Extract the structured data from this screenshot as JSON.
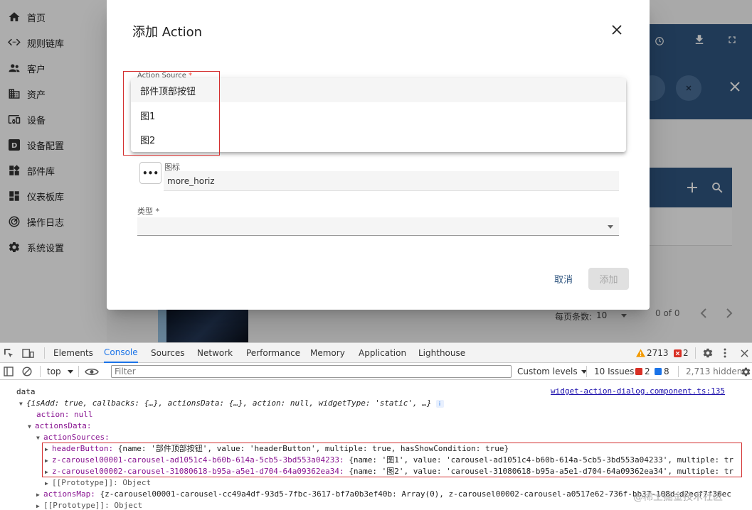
{
  "sidebar": {
    "items": [
      {
        "label": "首页",
        "icon": "home-icon"
      },
      {
        "label": "规则链库",
        "icon": "settings-ethernet-icon"
      },
      {
        "label": "客户",
        "icon": "supervisor-account-icon"
      },
      {
        "label": "资产",
        "icon": "domain-icon"
      },
      {
        "label": "设备",
        "icon": "devices-other-icon"
      },
      {
        "label": "设备配置",
        "icon": "device-profile-icon"
      },
      {
        "label": "部件库",
        "icon": "widgets-icon"
      },
      {
        "label": "仪表板库",
        "icon": "dashboard-icon"
      },
      {
        "label": "操作日志",
        "icon": "track-changes-icon"
      },
      {
        "label": "系统设置",
        "icon": "gear-icon"
      }
    ]
  },
  "background": {
    "paginator_label": "每页条数:",
    "paginator_value": "10",
    "paginator_range": "0 of 0"
  },
  "dialog": {
    "title": "添加 Action",
    "action_source_label": "Action Source",
    "required_mark": "*",
    "options": [
      "部件顶部按钮",
      "图1",
      "图2"
    ],
    "icon_label": "图标",
    "icon_value": "more_horiz",
    "type_label": "类型",
    "cancel_label": "取消",
    "add_label": "添加"
  },
  "devtools": {
    "tabs": [
      "Elements",
      "Console",
      "Sources",
      "Network",
      "Performance",
      "Memory",
      "Application",
      "Lighthouse"
    ],
    "active_tab": "Console",
    "warnings_count": "2713",
    "errors_count": "2",
    "context": "top",
    "filter_placeholder": "Filter",
    "levels_label": "Custom levels",
    "issues_label": "10 Issues:",
    "issues_errors": "2",
    "issues_info": "8",
    "hidden_label": "2,713 hidden",
    "source_link": "widget-action-dialog.component.ts:135"
  },
  "console": {
    "label": "data",
    "summary": "{isAdd: true, callbacks: {…}, actionsData: {…}, action: null, widgetType: 'static', …}",
    "action_line": "action: null",
    "actions_data": "actionsData:",
    "action_sources": "actionSources:",
    "header_button_key": "headerButton:",
    "header_button_val": "{name: '部件顶部按钮', value: 'headerButton', multiple: true, hasShowCondition: true}",
    "carousel1_key": "z-carousel00001-carousel-ad1051c4-b60b-614a-5cb5-3bd553a04233:",
    "carousel1_val": "{name: '图1', value: 'carousel-ad1051c4-b60b-614a-5cb5-3bd553a04233', multiple: tr",
    "carousel2_key": "z-carousel00002-carousel-31080618-b95a-a5e1-d704-64a09362ea34:",
    "carousel2_val": "{name: '图2', value: 'carousel-31080618-b95a-a5e1-d704-64a09362ea34', multiple: tr",
    "proto_inner": "[[Prototype]]: Object",
    "actions_map_key": "actionsMap:",
    "actions_map_val": "{z-carousel00001-carousel-cc49a4df-93d5-7fbc-3617-bf7a0b3ef40b: Array(0), z-carousel00002-carousel-a0517e62-736f-bb37-108d-d2ecf7f36ec",
    "proto_outer": "[[Prototype]]: Object"
  },
  "watermark": "@稀土掘金技术社区",
  "colors": {
    "primary": "#305680",
    "error": "#d32f2f",
    "link": "#1a73e8"
  }
}
